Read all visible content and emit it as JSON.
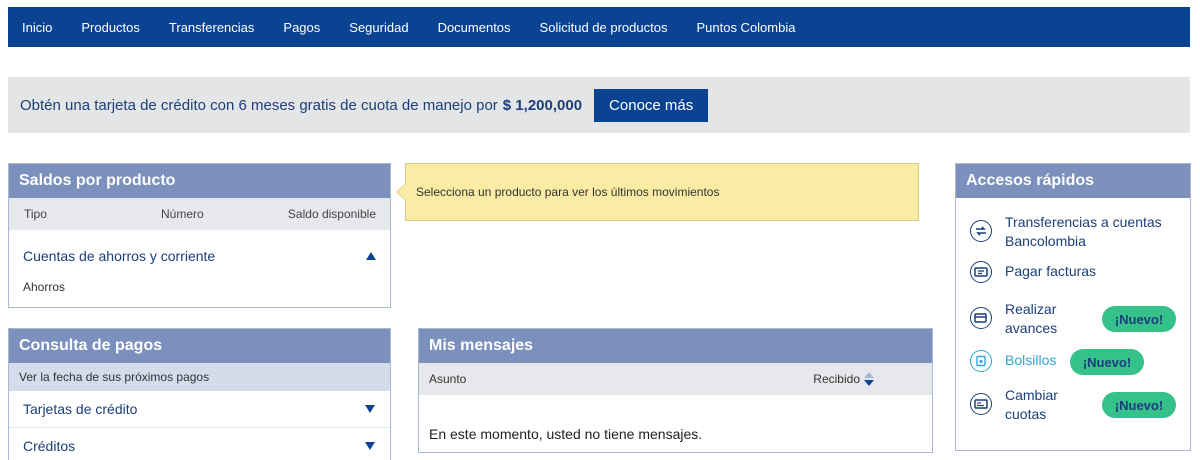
{
  "nav": {
    "items": [
      "Inicio",
      "Productos",
      "Transferencias",
      "Pagos",
      "Seguridad",
      "Documentos",
      "Solicitud de productos",
      "Puntos Colombia"
    ]
  },
  "promo": {
    "text": "Obtén una tarjeta de crédito con 6 meses gratis de cuota de manejo por",
    "amount": "$ 1,200,000",
    "button": "Conoce más"
  },
  "saldos": {
    "title": "Saldos por producto",
    "col_tipo": "Tipo",
    "col_numero": "Número",
    "col_saldo": "Saldo disponible",
    "group_label": "Cuentas de ahorros y corriente",
    "sub_label": "Ahorros"
  },
  "tooltip": {
    "text": "Selecciona un producto para ver los últimos movimientos"
  },
  "consulta": {
    "title": "Consulta de pagos",
    "subtitle": "Ver la fecha de sus próximos pagos",
    "rows": [
      "Tarjetas de crédito",
      "Créditos"
    ]
  },
  "mensajes": {
    "title": "Mis mensajes",
    "col_asunto": "Asunto",
    "col_recibido": "Recibido",
    "empty": "En este momento, usted no tiene mensajes."
  },
  "accesos": {
    "title": "Accesos rápidos",
    "items": [
      {
        "line1": "Transferencias a cuentas",
        "line2": "Bancolombia",
        "icon": "transfer-icon"
      },
      {
        "line1": "Pagar facturas",
        "icon": "bill-icon"
      },
      {
        "line1": "Realizar",
        "line2": "avances",
        "icon": "card-advance-icon",
        "badge": "¡Nuevo!"
      },
      {
        "line1": "Bolsillos",
        "icon": "pocket-icon",
        "badge": "¡Nuevo!"
      },
      {
        "line1": "Cambiar",
        "line2": "cuotas",
        "icon": "change-installments-icon",
        "badge": "¡Nuevo!"
      }
    ]
  },
  "colors": {
    "nav_bg": "#0a4392",
    "panel_header": "#7b90bd",
    "badge_green": "#35c18a",
    "tooltip_bg": "#faeba5",
    "link_blue": "#1b3f7a",
    "bolsillos_cyan": "#2aa8d8"
  }
}
